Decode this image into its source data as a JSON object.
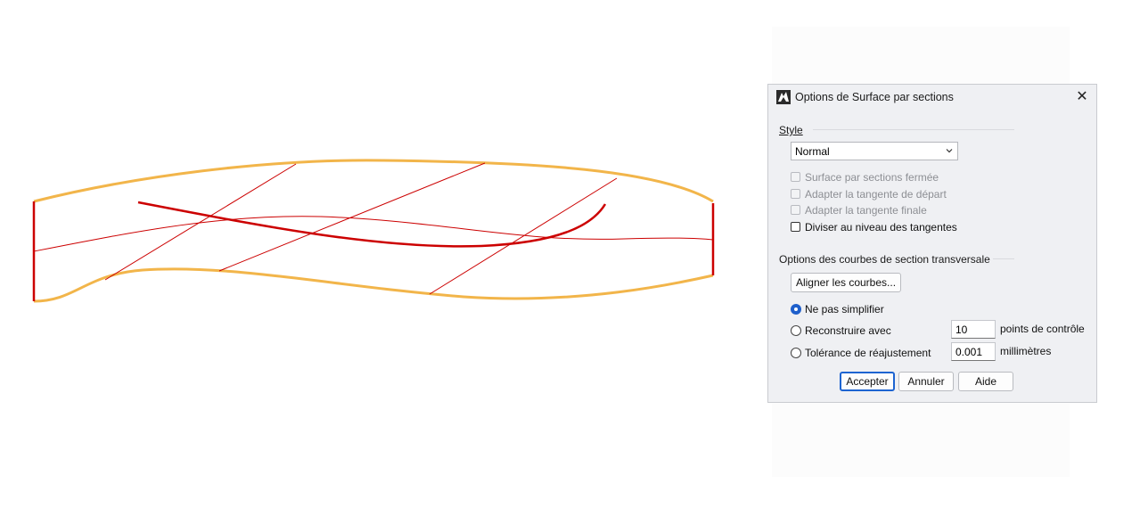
{
  "dialog": {
    "title": "Options de Surface par sections",
    "style_section": "Style",
    "style_select_value": "Normal",
    "checkboxes": [
      {
        "label": "Surface par sections fermée",
        "enabled": false,
        "checked": false
      },
      {
        "label": "Adapter la tangente de départ",
        "enabled": false,
        "checked": false
      },
      {
        "label": "Adapter la tangente finale",
        "enabled": false,
        "checked": false
      },
      {
        "label": "Diviser au niveau des tangentes",
        "enabled": true,
        "checked": false
      }
    ],
    "cross_section_title": "Options des courbes de section transversale",
    "align_button": "Aligner les courbes...",
    "radios": [
      {
        "label": "Ne pas simplifier",
        "checked": true
      },
      {
        "label": "Reconstruire avec",
        "checked": false
      },
      {
        "label": "Tolérance de réajustement",
        "checked": false
      }
    ],
    "rebuild_points_value": "10",
    "rebuild_points_unit": "points de contrôle",
    "tolerance_value": "0.001",
    "tolerance_unit": "millimètres",
    "buttons": {
      "accept": "Accepter",
      "cancel": "Annuler",
      "help": "Aide"
    }
  },
  "colors": {
    "edge_curve": "#f2b54a",
    "section_curve": "#cc0000",
    "accent": "#1e5fcb",
    "dialog_bg": "#eff0f3"
  }
}
